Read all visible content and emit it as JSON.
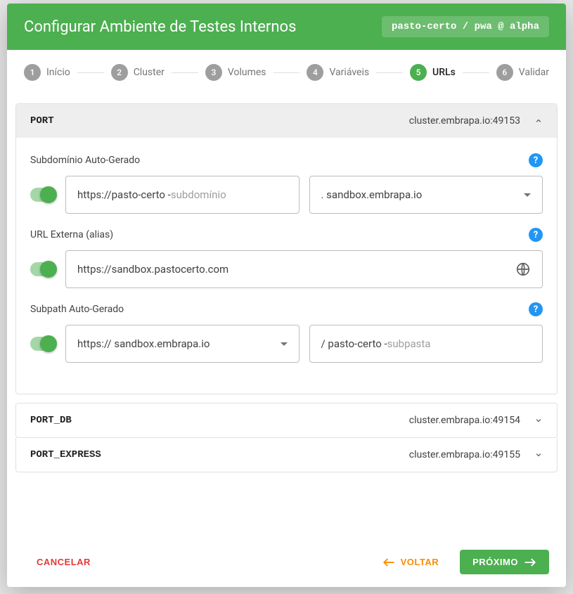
{
  "header": {
    "title": "Configurar Ambiente de Testes Internos",
    "breadcrumb": "pasto-certo / pwa @ alpha"
  },
  "stepper": [
    {
      "num": "1",
      "label": "Início"
    },
    {
      "num": "2",
      "label": "Cluster"
    },
    {
      "num": "3",
      "label": "Volumes"
    },
    {
      "num": "4",
      "label": "Variáveis"
    },
    {
      "num": "5",
      "label": "URLs"
    },
    {
      "num": "6",
      "label": "Validar"
    }
  ],
  "panel_port": {
    "title": "PORT",
    "host": "cluster.embrapa.io:49153"
  },
  "subdomain": {
    "label": "Subdomínio Auto-Gerado",
    "prefix": "https://pasto-certo - ",
    "placeholder": "subdomínio",
    "domain": ". sandbox.embrapa.io"
  },
  "external": {
    "label": "URL Externa (alias)",
    "prefix": "https:// ",
    "value": "sandbox.pastocerto.com"
  },
  "subpath": {
    "label": "Subpath Auto-Gerado",
    "base": "https:// sandbox.embrapa.io",
    "prefix": "/ pasto-certo - ",
    "placeholder": "subpasta"
  },
  "panel_db": {
    "title": "PORT_DB",
    "host": "cluster.embrapa.io:49154"
  },
  "panel_express": {
    "title": "PORT_EXPRESS",
    "host": "cluster.embrapa.io:49155"
  },
  "footer": {
    "cancel": "CANCELAR",
    "back": "VOLTAR",
    "next": "PRÓXIMO"
  }
}
